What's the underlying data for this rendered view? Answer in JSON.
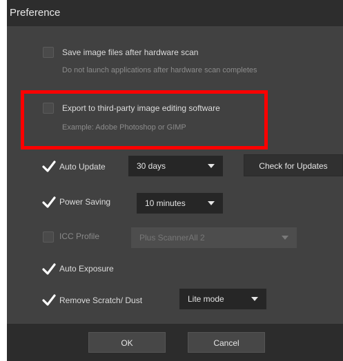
{
  "window": {
    "title": "Preference"
  },
  "options": {
    "save_image_files": {
      "label": "Save image files after hardware scan",
      "description": "Do not launch applications after hardware scan completes",
      "checked": false
    },
    "export_third_party": {
      "label": "Export to third-party image editing software",
      "description": "Example: Adobe Photoshop or GIMP",
      "checked": false
    },
    "auto_update": {
      "label": "Auto Update",
      "checked": true,
      "selected": "30 days",
      "check_button": "Check for Updates"
    },
    "power_saving": {
      "label": "Power Saving",
      "checked": true,
      "selected": "10 minutes"
    },
    "icc_profile": {
      "label": "ICC Profile",
      "checked": false,
      "selected": "Plus ScannerAll 2"
    },
    "auto_exposure": {
      "label": "Auto Exposure",
      "checked": true
    },
    "remove_scratch": {
      "label": "Remove Scratch/ Dust",
      "checked": true,
      "selected": "Lite mode"
    }
  },
  "footer": {
    "ok_label": "OK",
    "cancel_label": "Cancel"
  },
  "colors": {
    "highlight": "#ff0000",
    "background": "#414141",
    "titlebar": "#2d2d2d"
  }
}
